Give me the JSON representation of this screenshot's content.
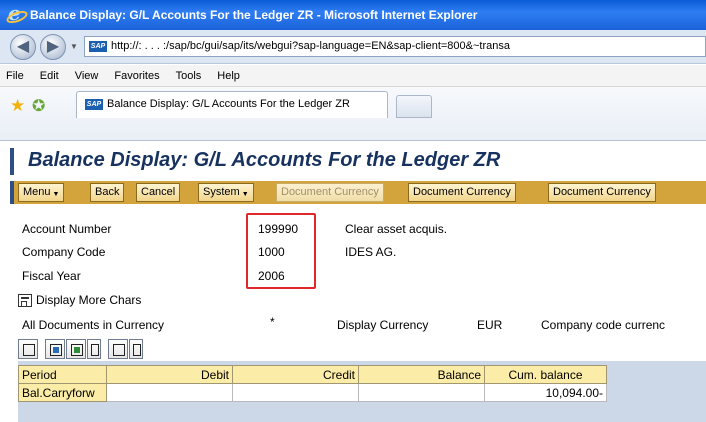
{
  "window": {
    "title": "Balance Display: G/L Accounts For the Ledger ZR - Microsoft Internet Explorer"
  },
  "browser": {
    "address": "http://:          .         .         .       :/sap/bc/gui/sap/its/webgui?sap-language=EN&sap-client=800&~transa",
    "menu": [
      "File",
      "Edit",
      "View",
      "Favorites",
      "Tools",
      "Help"
    ],
    "tab_label": "Balance Display: G/L Accounts For the Ledger ZR"
  },
  "sap": {
    "title": "Balance Display: G/L Accounts For the Ledger ZR",
    "toolbar": [
      {
        "label": "Menu",
        "has_arrow": true,
        "enabled": true
      },
      {
        "label": "Back",
        "has_arrow": false,
        "enabled": true
      },
      {
        "label": "Cancel",
        "has_arrow": false,
        "enabled": true
      },
      {
        "label": "System",
        "has_arrow": true,
        "enabled": true
      },
      {
        "label": "Document Currency",
        "has_arrow": false,
        "enabled": false
      },
      {
        "label": "Document Currency",
        "has_arrow": false,
        "enabled": true
      },
      {
        "label": "Document Currency",
        "has_arrow": false,
        "enabled": true
      }
    ],
    "fields": {
      "account_number_label": "Account Number",
      "account_number_value": "199990",
      "account_description": "Clear asset acquis.",
      "company_code_label": "Company Code",
      "company_code_value": "1000",
      "company_name": "IDES AG.",
      "fiscal_year_label": "Fiscal Year",
      "fiscal_year_value": "2006"
    },
    "display_more_chars": "Display More Chars",
    "currency_row": {
      "label": "All Documents in Currency",
      "value": "*",
      "display_currency_label": "Display Currency",
      "display_currency_value": "EUR",
      "company_code_currency": "Company code currenc"
    },
    "table": {
      "headers": [
        "Period",
        "Debit",
        "Credit",
        "Balance",
        "Cum. balance"
      ],
      "rows": [
        [
          "Bal.Carryforw",
          "",
          "",
          "",
          "10,094.00-"
        ]
      ]
    }
  },
  "colors": {
    "title_bar": "#1a62d9",
    "sap_toolbar": "#d3a43b",
    "highlight_box": "#e0282b",
    "alv_header": "#fbeda7"
  }
}
